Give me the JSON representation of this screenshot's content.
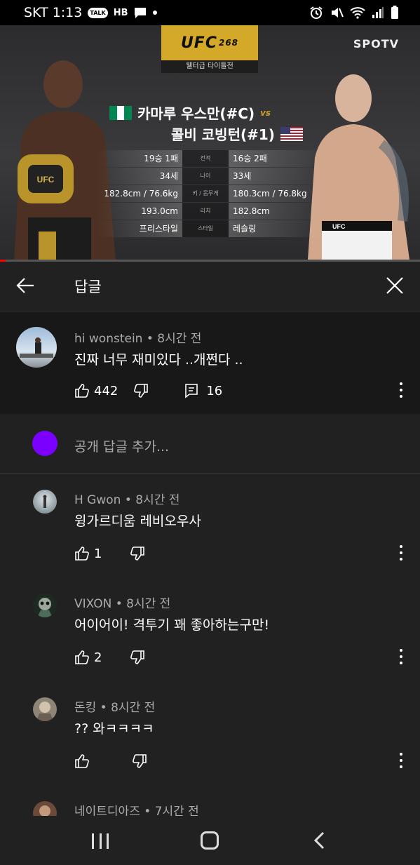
{
  "status_bar": {
    "carrier_time": "SKT 1:13",
    "talk_label": "TALK",
    "hb_label": "HB"
  },
  "video": {
    "event_logo": "UFC",
    "event_number": "268",
    "event_subtitle": "웰터급 타이틀전",
    "broadcaster": "SPOTV",
    "fighter1": "카마루 우스만(#C)",
    "vs": "vs",
    "fighter2": "콜비 코빙턴(#1)",
    "stats": [
      {
        "left": "19승 1패",
        "label": "전적",
        "right": "16승 2패"
      },
      {
        "left": "34세",
        "label": "나이",
        "right": "33세"
      },
      {
        "left": "182.8cm / 76.6kg",
        "label": "키 / 몸무게",
        "right": "180.3cm / 76.8kg"
      },
      {
        "left": "193.0cm",
        "label": "리치",
        "right": "182.8cm"
      },
      {
        "left": "프리스타일",
        "label": "스타일",
        "right": "레슬링"
      }
    ]
  },
  "header": {
    "title": "답글"
  },
  "parent_comment": {
    "meta": "hi wonstein • 8시간 전",
    "text": "진짜 너무 재미있다 ..개쩐다 ..",
    "likes": "442",
    "replies": "16"
  },
  "add_reply": {
    "placeholder": "공개 답글 추가..."
  },
  "replies": [
    {
      "meta": "H Gwon • 8시간 전",
      "text": "윙가르디움 레비오우사",
      "likes": "1"
    },
    {
      "meta": "VIXON • 8시간 전",
      "text": "어이어이! 격투기 꽤 좋아하는구만!",
      "likes": "2"
    },
    {
      "meta": "돈킹 • 8시간 전",
      "text": "?? 와ㅋㅋㅋㅋ",
      "likes": ""
    },
    {
      "meta": "네이트디아즈 • 7시간 전"
    }
  ],
  "colors": {
    "background": "#212121",
    "parent_background": "#181818",
    "accent_avatar": "#7b00ff",
    "progress": "#ff0000",
    "ufc_gold": "#d4a92a"
  }
}
